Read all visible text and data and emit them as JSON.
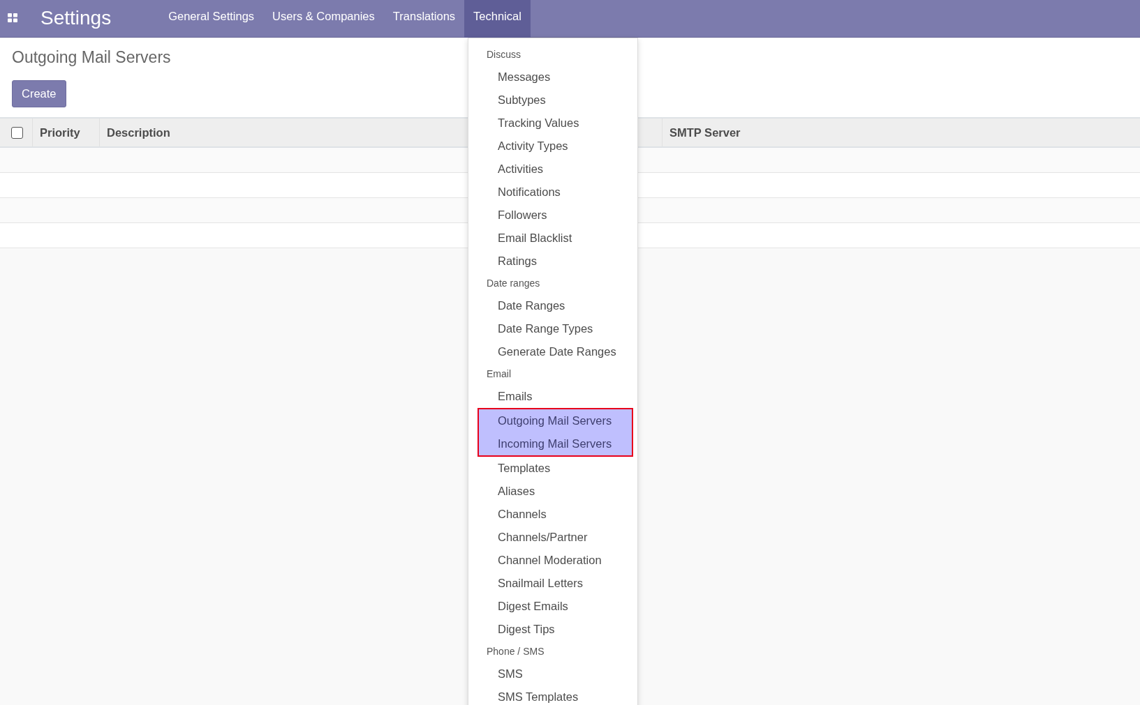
{
  "navbar": {
    "app_title": "Settings",
    "menus": [
      {
        "label": "General Settings",
        "selected": false
      },
      {
        "label": "Users & Companies",
        "selected": false
      },
      {
        "label": "Translations",
        "selected": false
      },
      {
        "label": "Technical",
        "selected": true
      }
    ]
  },
  "page": {
    "title": "Outgoing Mail Servers",
    "create_button": "Create"
  },
  "table": {
    "select_all_checked": false,
    "columns": [
      "Priority",
      "Description",
      "SMTP Server"
    ]
  },
  "dropdown": {
    "sections": [
      {
        "header": "Discuss",
        "items": [
          {
            "label": "Messages",
            "highlighted": false
          },
          {
            "label": "Subtypes",
            "highlighted": false
          },
          {
            "label": "Tracking Values",
            "highlighted": false
          },
          {
            "label": "Activity Types",
            "highlighted": false
          },
          {
            "label": "Activities",
            "highlighted": false
          },
          {
            "label": "Notifications",
            "highlighted": false
          },
          {
            "label": "Followers",
            "highlighted": false
          },
          {
            "label": "Email Blacklist",
            "highlighted": false
          },
          {
            "label": "Ratings",
            "highlighted": false
          }
        ]
      },
      {
        "header": "Date ranges",
        "items": [
          {
            "label": "Date Ranges",
            "highlighted": false
          },
          {
            "label": "Date Range Types",
            "highlighted": false
          },
          {
            "label": "Generate Date Ranges",
            "highlighted": false
          }
        ]
      },
      {
        "header": "Email",
        "items": [
          {
            "label": "Emails",
            "highlighted": false
          },
          {
            "label": "Outgoing Mail Servers",
            "highlighted": true
          },
          {
            "label": "Incoming Mail Servers",
            "highlighted": true
          },
          {
            "label": "Templates",
            "highlighted": false
          },
          {
            "label": "Aliases",
            "highlighted": false
          },
          {
            "label": "Channels",
            "highlighted": false
          },
          {
            "label": "Channels/Partner",
            "highlighted": false
          },
          {
            "label": "Channel Moderation",
            "highlighted": false
          },
          {
            "label": "Snailmail Letters",
            "highlighted": false
          },
          {
            "label": "Digest Emails",
            "highlighted": false
          },
          {
            "label": "Digest Tips",
            "highlighted": false
          }
        ]
      },
      {
        "header": "Phone / SMS",
        "items": [
          {
            "label": "SMS",
            "highlighted": false
          },
          {
            "label": "SMS Templates",
            "highlighted": false
          }
        ]
      }
    ]
  }
}
